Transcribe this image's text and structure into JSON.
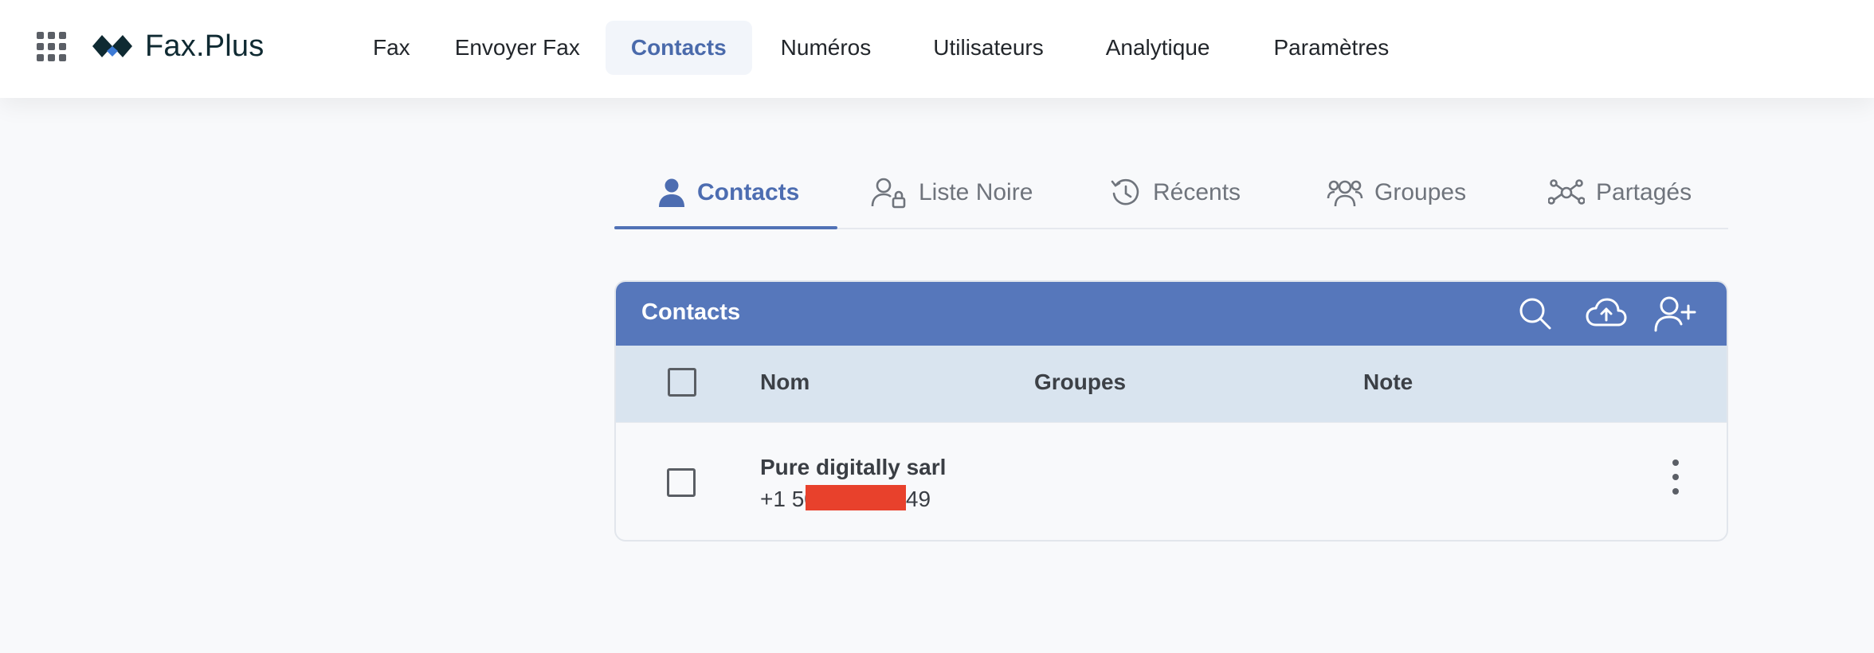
{
  "header": {
    "logo_text": "Fax.Plus",
    "nav": [
      {
        "label": "Fax"
      },
      {
        "label": "Envoyer Fax"
      },
      {
        "label": "Contacts",
        "active": true
      },
      {
        "label": "Numéros"
      },
      {
        "label": "Utilisateurs"
      },
      {
        "label": "Analytique"
      },
      {
        "label": "Paramètres"
      }
    ]
  },
  "tabs": [
    {
      "label": "Contacts",
      "icon": "person-icon",
      "active": true
    },
    {
      "label": "Liste Noire",
      "icon": "person-lock-icon"
    },
    {
      "label": "Récents",
      "icon": "history-icon"
    },
    {
      "label": "Groupes",
      "icon": "group-icon"
    },
    {
      "label": "Partagés",
      "icon": "share-network-icon"
    }
  ],
  "card": {
    "title": "Contacts",
    "actions": [
      "search-icon",
      "cloud-upload-icon",
      "add-person-icon"
    ],
    "columns": [
      "Nom",
      "Groupes",
      "Note"
    ],
    "rows": [
      {
        "name": "Pure digitally sarl",
        "phone": "+1 507-670-4149",
        "groups": "",
        "note": ""
      }
    ]
  },
  "colors": {
    "accent": "#5677bb",
    "accent_text": "#4d6db1",
    "column_header_bg": "#d9e4ef",
    "redaction": "#e8412c"
  }
}
